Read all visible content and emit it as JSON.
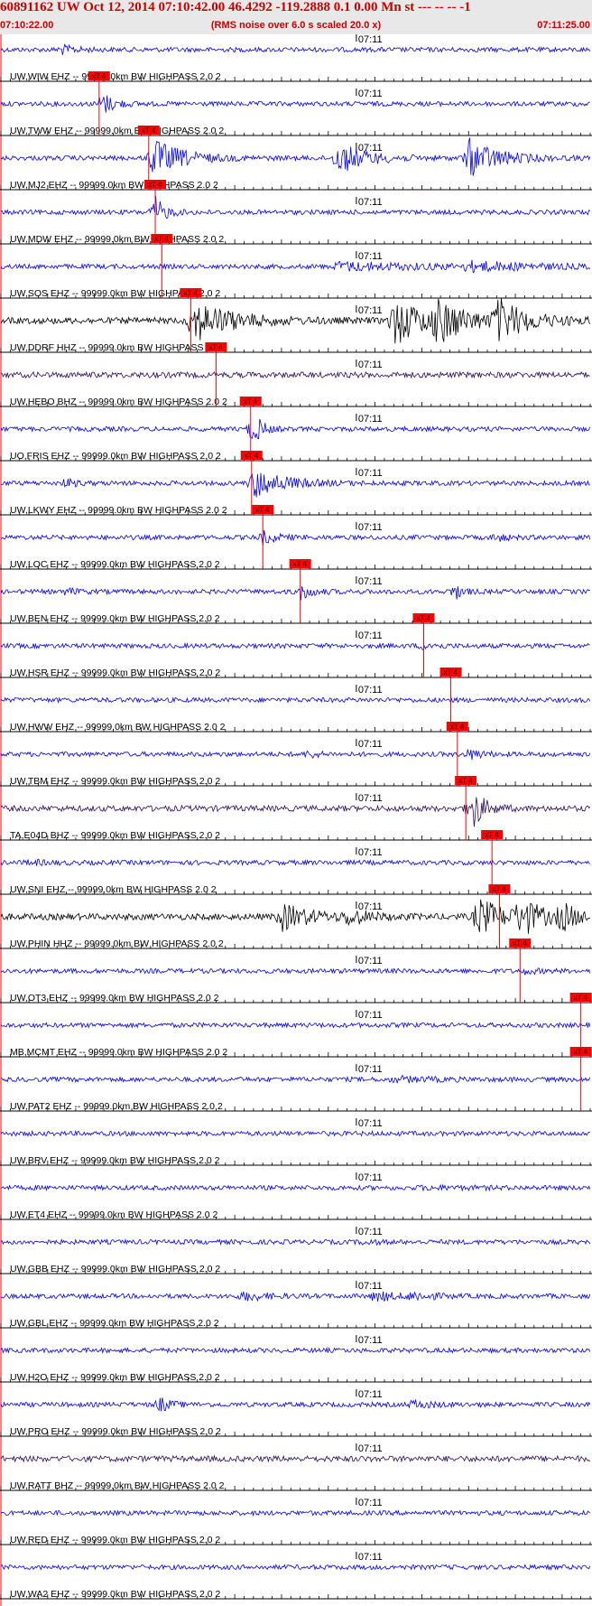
{
  "header": {
    "title": "60891162 UW Oct 12, 2014 07:10:42.00   46.4292 -119.2888  0.1 0.00 Mn st --- -- --   -1",
    "start_time": "07:10:22.00",
    "subtitle": "(RMS noise over 6.0 s scaled 20.0 x)",
    "end_time": "07:11:25.00"
  },
  "chart_data": {
    "type": "line",
    "title": "60891162 UW Oct 12, 2014 07:10:42.00",
    "time_range": [
      "07:10:22.00",
      "07:11:25.00"
    ],
    "minute_mark_label": "07:11",
    "minute_mark_seconds": 38,
    "total_seconds": 63,
    "pick_label": "xT 4",
    "colors": {
      "blue": "#0000ff",
      "black": "#000000",
      "navy": "#2a0a5e",
      "pick": "#ff0000"
    },
    "traces": [
      {
        "label": "UW,WIW EHZ -- 99999.0km BW  HIGHPASS  2.0  2",
        "color": "blue",
        "pick_s": null,
        "bursts": [
          [
            6.5,
            1.5,
            2
          ]
        ]
      },
      {
        "label": "UW,TWW EHZ -- 99999.0km BW  HIGHPASS  2.0  2",
        "color": "blue",
        "pick_s": 10.5,
        "bursts": [
          [
            10.8,
            1.2,
            4
          ]
        ]
      },
      {
        "label": "UW,MJ2 EHZ -- 99999.0km BW  HIGHPASS  2.0  2",
        "color": "blue",
        "pick_s": 15.8,
        "bursts": [
          [
            16.2,
            3,
            6
          ],
          [
            36,
            3,
            5
          ],
          [
            50,
            3,
            6
          ]
        ]
      },
      {
        "label": "UW,MDW EHZ -- 99999.0km BW  HIGHPASS  2.0  2",
        "color": "blue",
        "pick_s": 16.5,
        "bursts": [
          [
            16.5,
            1,
            5
          ]
        ]
      },
      {
        "label": "UW,SOS EHZ -- 99999.0km BW  HIGHPASS  2.0  2",
        "color": "blue",
        "pick_s": 17.2,
        "bursts": [
          [
            36,
            10,
            2
          ],
          [
            50,
            6,
            2
          ]
        ]
      },
      {
        "label": "UW,DDRF HHZ -- 99999.0km BW  HIGHPASS  2.0  2",
        "color": "black",
        "pick_s": 20.3,
        "bursts": [
          [
            20.5,
            4,
            5
          ],
          [
            42,
            3,
            6
          ],
          [
            46.5,
            3,
            5
          ],
          [
            53,
            3,
            5
          ]
        ]
      },
      {
        "label": "UW,HEBO BHZ -- 99999.0km BW  HIGHPASS  2.0  2",
        "color": "navy",
        "pick_s": 23.0,
        "bursts": []
      },
      {
        "label": "UO,FRIS EHZ -- 99999.0km BW  HIGHPASS  2.0  2",
        "color": "blue",
        "pick_s": 26.7,
        "bursts": [
          [
            27,
            0.8,
            6
          ]
        ]
      },
      {
        "label": "UW,LKWY EHZ -- 99999.0km BW  HIGHPASS  2.0  2",
        "color": "blue",
        "pick_s": 26.8,
        "bursts": [
          [
            27,
            3,
            5
          ],
          [
            7,
            1,
            2
          ]
        ]
      },
      {
        "label": "UW,LOC EHZ -- 99999.0km BW  HIGHPASS  2.0  2",
        "color": "blue",
        "pick_s": 28.0,
        "bursts": [
          [
            28,
            1.5,
            2.5
          ],
          [
            53,
            1,
            2
          ]
        ]
      },
      {
        "label": "UW,BEN EHZ -- 99999.0km BW  HIGHPASS  2.0  2",
        "color": "blue",
        "pick_s": 32.0,
        "bursts": [
          [
            32,
            1.2,
            3
          ],
          [
            7,
            1,
            1.8
          ],
          [
            48.5,
            0.8,
            3
          ]
        ]
      },
      {
        "label": "UW,HSR EHZ -- 99999.0km BW  HIGHPASS  2.0  2",
        "color": "blue",
        "pick_s": 45.2,
        "bursts": [
          [
            45.2,
            1.2,
            2
          ]
        ]
      },
      {
        "label": "UW,HWW EHZ -- 99999.0km BW  HIGHPASS  2.0  2",
        "color": "blue",
        "pick_s": 48.1,
        "bursts": []
      },
      {
        "label": "UW,TBM EHZ -- 99999.0km BW  HIGHPASS  2.0  2",
        "color": "blue",
        "pick_s": 48.8,
        "bursts": [
          [
            50,
            1.2,
            2.5
          ],
          [
            33,
            0.8,
            2
          ]
        ]
      },
      {
        "label": "TA,E04D BHZ -- 99999.0km BW  HIGHPASS  2.0  2",
        "color": "navy",
        "pick_s": 49.7,
        "bursts": [
          [
            50.3,
            1.2,
            6
          ]
        ]
      },
      {
        "label": "UW,SNI EHZ -- 99999.0km BW  HIGHPASS  2.0  2",
        "color": "blue",
        "pick_s": 52.5,
        "bursts": [
          [
            3,
            2,
            1.5
          ]
        ]
      },
      {
        "label": "UW,PHIN HHZ -- 99999.0km BW  HIGHPASS  2.0  2",
        "color": "black",
        "pick_s": 53.3,
        "bursts": [
          [
            30,
            3,
            3.5
          ],
          [
            37,
            2,
            2.5
          ],
          [
            51,
            3,
            4.5
          ],
          [
            55.5,
            2,
            4.5
          ],
          [
            60,
            1.5,
            3.5
          ]
        ]
      },
      {
        "label": "UW,OT3 EHZ -- 99999.0km BW  HIGHPASS  2.0  2",
        "color": "blue",
        "pick_s": 55.5,
        "bursts": [
          [
            56,
            1.5,
            1.5
          ]
        ]
      },
      {
        "label": "MB,MCMT EHZ -- 99999.0km BW  HIGHPASS  2.0  2",
        "color": "blue",
        "pick_s": 62.0,
        "bursts": []
      },
      {
        "label": "UW,PAT2 EHZ -- 99999.0km BW  HIGHPASS  2.0  2",
        "color": "blue",
        "pick_s": 62.0,
        "bursts": [
          [
            42,
            4,
            1.6
          ]
        ]
      },
      {
        "label": "UW,BRV EHZ -- 99999.0km BW  HIGHPASS  2.0  2",
        "color": "blue",
        "pick_s": null,
        "bursts": []
      },
      {
        "label": "UW,ET4 EHZ -- 99999.0km BW  HIGHPASS  2.0  2",
        "color": "blue",
        "pick_s": null,
        "bursts": [
          [
            45,
            5,
            1.3
          ]
        ]
      },
      {
        "label": "UW,GBB EHZ -- 99999.0km BW  HIGHPASS  2.0  2",
        "color": "blue",
        "pick_s": null,
        "bursts": [
          [
            39,
            1,
            1.6
          ]
        ]
      },
      {
        "label": "UW,GBL EHZ -- 99999.0km BW  HIGHPASS  2.0  2",
        "color": "blue",
        "pick_s": null,
        "bursts": [
          [
            26,
            2,
            2.2
          ],
          [
            40,
            2,
            2.3
          ],
          [
            44,
            2,
            2
          ]
        ]
      },
      {
        "label": "UW,H2O EHZ -- 99999.0km BW  HIGHPASS  2.0  2",
        "color": "blue",
        "pick_s": null,
        "bursts": []
      },
      {
        "label": "UW,PRO EHZ -- 99999.0km BW  HIGHPASS  2.0  2",
        "color": "blue",
        "pick_s": null,
        "bursts": [
          [
            17,
            1,
            3
          ],
          [
            44,
            2,
            2
          ]
        ]
      },
      {
        "label": "UW,RATT BHZ -- 99999.0km BW  HIGHPASS  2.0  2",
        "color": "navy",
        "pick_s": null,
        "bursts": []
      },
      {
        "label": "UW,RED EHZ -- 99999.0km BW  HIGHPASS  2.0  2",
        "color": "blue",
        "pick_s": null,
        "bursts": []
      },
      {
        "label": "UW,WA2 EHZ -- 99999.0km BW  HIGHPASS  2.0  2",
        "color": "blue",
        "pick_s": null,
        "bursts": []
      }
    ]
  }
}
